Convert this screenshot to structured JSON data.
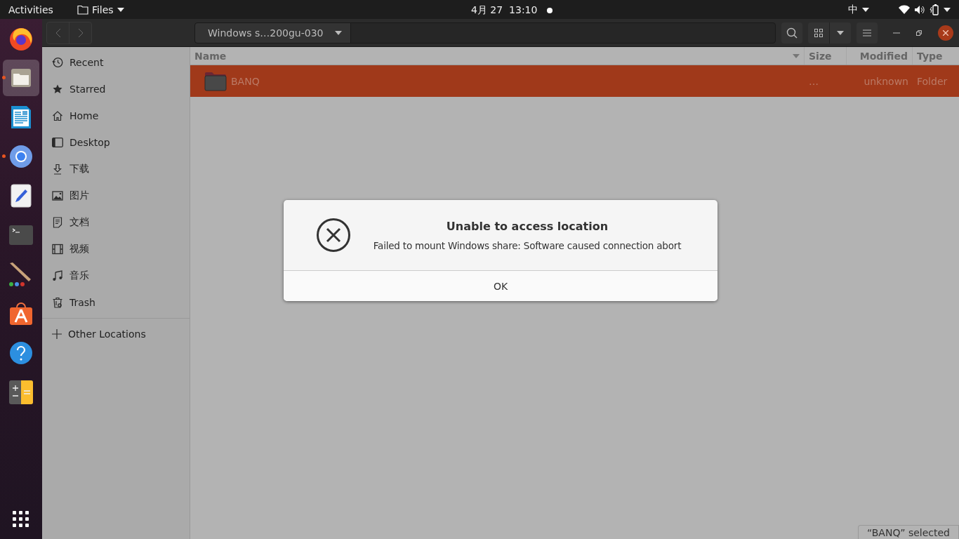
{
  "top_bar": {
    "activities": "Activities",
    "app_menu": "Files",
    "clock": "4月 27  13:10",
    "input_method": "中"
  },
  "dock": [
    {
      "kind": "firefox",
      "running": false,
      "selected": false
    },
    {
      "kind": "files",
      "running": true,
      "selected": true
    },
    {
      "kind": "writer",
      "running": false,
      "selected": false
    },
    {
      "kind": "chromium",
      "running": true,
      "selected": false
    },
    {
      "kind": "editor",
      "running": false,
      "selected": false
    },
    {
      "kind": "terminal",
      "running": false,
      "selected": false
    },
    {
      "kind": "paint",
      "running": false,
      "selected": false
    },
    {
      "kind": "store",
      "running": false,
      "selected": false
    },
    {
      "kind": "help",
      "running": false,
      "selected": false
    },
    {
      "kind": "calculator",
      "running": false,
      "selected": false
    }
  ],
  "header_bar": {
    "path": "Windows s…200gu-030"
  },
  "sidebar": {
    "items": [
      {
        "kind": "recent",
        "label": "Recent",
        "selected": false
      },
      {
        "kind": "starred",
        "label": "Starred",
        "selected": false
      },
      {
        "kind": "home",
        "label": "Home",
        "selected": false
      },
      {
        "kind": "desktop",
        "label": "Desktop",
        "selected": false
      },
      {
        "kind": "download",
        "label": "下载",
        "selected": false
      },
      {
        "kind": "pictures",
        "label": "图片",
        "selected": false
      },
      {
        "kind": "documents",
        "label": "文档",
        "selected": false
      },
      {
        "kind": "videos",
        "label": "视频",
        "selected": false
      },
      {
        "kind": "music",
        "label": "音乐",
        "selected": false
      },
      {
        "kind": "trash",
        "label": "Trash",
        "selected": false
      }
    ],
    "other_locations": "Other Locations"
  },
  "table": {
    "columns": [
      "Name",
      "Size",
      "Modified",
      "Type"
    ],
    "rows": [
      {
        "name": "BANQ",
        "size": "…",
        "modified": "unknown",
        "type": "Folder",
        "selected": true
      }
    ]
  },
  "dialog": {
    "title": "Unable to access location",
    "message": "Failed to mount Windows share: Software caused connection abort",
    "button": "OK"
  },
  "status_bar": "“BANQ” selected"
}
